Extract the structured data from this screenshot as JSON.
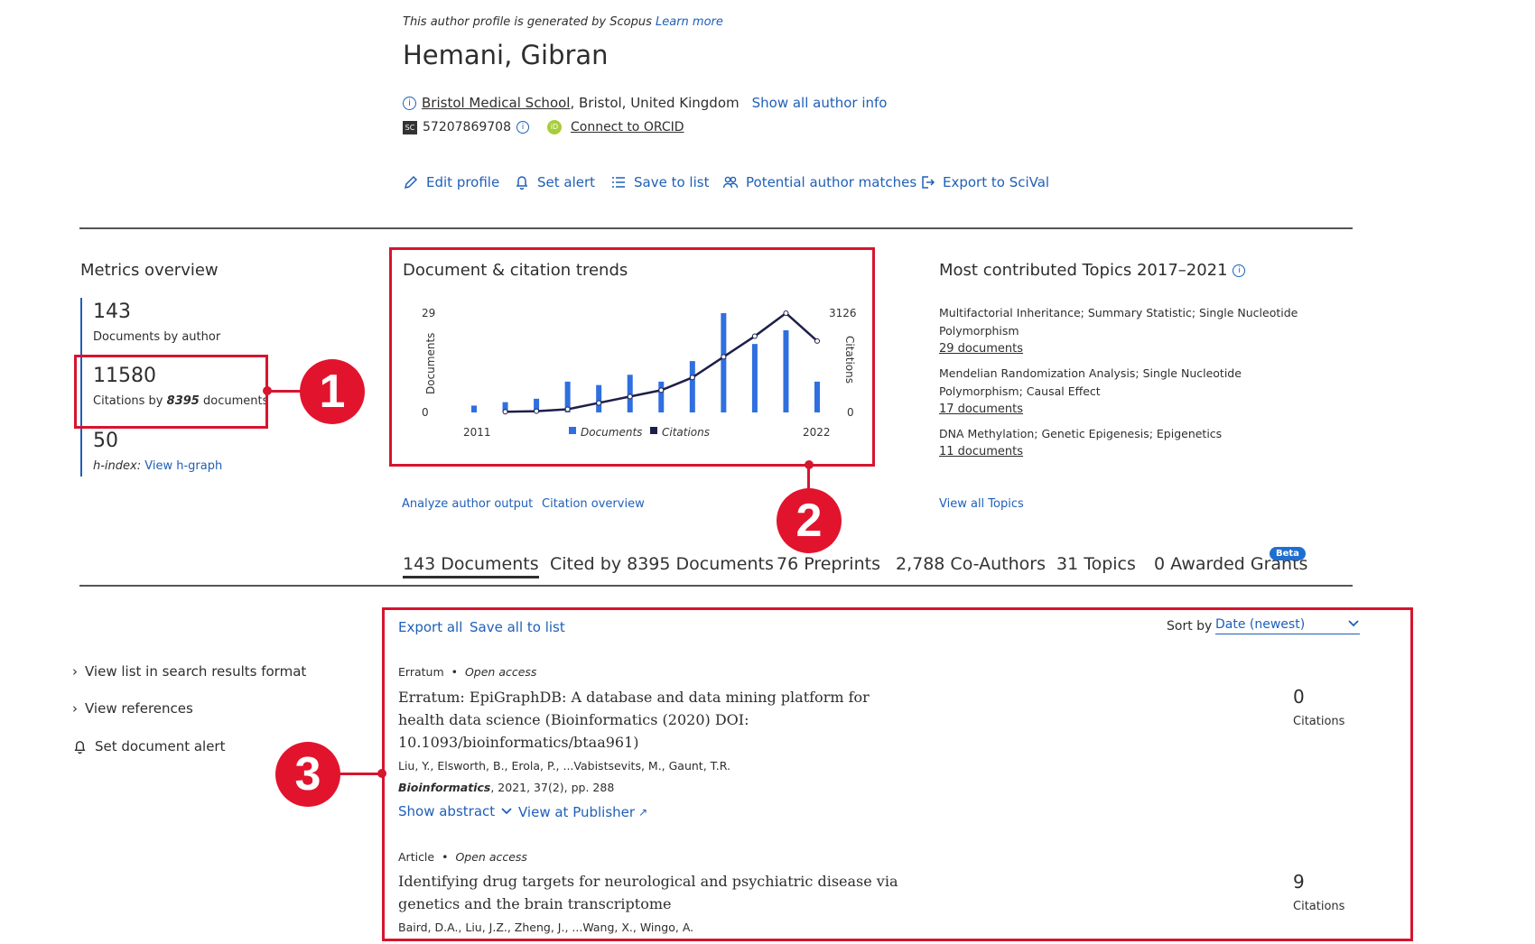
{
  "header": {
    "generated_note": "This author profile is generated by Scopus",
    "learn_more": "Learn more",
    "author_name": "Hemani, Gibran",
    "affiliation_link": "Bristol Medical School",
    "affiliation_rest": ", Bristol, United Kingdom",
    "show_all_info": "Show all author info",
    "scopus_id_badge": "SC",
    "scopus_id": "57207869708",
    "orcid_badge": "iD",
    "connect_orcid": "Connect to ORCID"
  },
  "actions": {
    "edit_profile": "Edit profile",
    "set_alert": "Set alert",
    "save_to_list": "Save to list",
    "potential_matches": "Potential author matches",
    "export_scival": "Export to SciVal"
  },
  "metrics": {
    "heading": "Metrics overview",
    "documents_value": "143",
    "documents_label": "Documents by author",
    "citations_value": "11580",
    "citations_label_pre": "Citations by",
    "citations_docs": "8395",
    "citations_label_post": "documents",
    "h_index_value": "50",
    "h_index_label": "h-index:",
    "view_h_graph": "View h-graph"
  },
  "trends": {
    "heading": "Document & citation trends",
    "analyze_output": "Analyze author output",
    "citation_overview": "Citation overview"
  },
  "chart_data": {
    "type": "bar",
    "title": "Document & citation trends",
    "x_start_label": "2011",
    "x_end_label": "2022",
    "ylabel": "Documents",
    "y2label": "Citations",
    "ylim": [
      0,
      29
    ],
    "y2lim": [
      0,
      3126
    ],
    "y_tick_labels": [
      "0",
      "29"
    ],
    "y2_tick_labels": [
      "0",
      "3126"
    ],
    "categories": [
      "2011",
      "2012",
      "2013",
      "2014",
      "2015",
      "2016",
      "2017",
      "2018",
      "2019",
      "2020",
      "2021",
      "2022"
    ],
    "series": [
      {
        "name": "Documents",
        "type": "bar",
        "color": "#2f6fdf",
        "values": [
          2,
          3,
          4,
          9,
          8,
          11,
          9,
          15,
          29,
          20,
          24,
          9
        ]
      },
      {
        "name": "Citations",
        "type": "line",
        "color": "#1c1f4a",
        "values": [
          null,
          20,
          40,
          100,
          300,
          500,
          700,
          1100,
          1750,
          2400,
          3126,
          2250
        ]
      }
    ],
    "legend": "bottom",
    "grid": false
  },
  "topics": {
    "heading": "Most contributed Topics 2017–2021",
    "items": [
      {
        "title": "Multifactorial Inheritance; Summary Statistic; Single Nucleotide Polymorphism",
        "docs": "29 documents"
      },
      {
        "title": "Mendelian Randomization Analysis; Single Nucleotide Polymorphism; Causal Effect",
        "docs": "17 documents"
      },
      {
        "title": "DNA Methylation; Genetic Epigenesis; Epigenetics",
        "docs": "11 documents"
      }
    ],
    "view_all": "View all Topics"
  },
  "tabs": {
    "documents": "143 Documents",
    "cited_by": "Cited by 8395 Documents",
    "preprints": "76 Preprints",
    "coauthors": "2,788 Co-Authors",
    "topics": "31 Topics",
    "grants": "0 Awarded Grants",
    "beta_badge": "Beta"
  },
  "sidebar": {
    "view_list": "View list in search results format",
    "view_references": "View references",
    "set_doc_alert": "Set document alert"
  },
  "results": {
    "export_all": "Export all",
    "save_all": "Save all to list",
    "sort_by_label": "Sort by",
    "sort_value": "Date (newest)",
    "items": [
      {
        "doc_type": "Erratum",
        "access": "Open access",
        "title_line1": "Erratum: EpiGraphDB: A database and data mining platform for",
        "title_line2": "health data science (Bioinformatics (2020) DOI:",
        "title_line3": "10.1093/bioinformatics/btaa961)",
        "authors": "Liu, Y., Elsworth, B., Erola, P., ...Vabistsevits, M., Gaunt, T.R.",
        "journal": "Bioinformatics",
        "journal_rest": ", 2021, 37(2), pp. 288",
        "show_abstract": "Show abstract",
        "view_publisher": "View at Publisher",
        "citations": "0",
        "citations_label": "Citations"
      },
      {
        "doc_type": "Article",
        "access": "Open access",
        "title_line1": "Identifying drug targets for neurological and psychiatric disease via",
        "title_line2": "genetics and the brain transcriptome",
        "authors": "Baird, D.A., Liu, J.Z., Zheng, J., ...Wang, X., Wingo, A.",
        "citations": "9",
        "citations_label": "Citations"
      }
    ]
  },
  "annotations": {
    "marker1": "1",
    "marker2": "2",
    "marker3": "3",
    "accent": "#e2142d"
  }
}
